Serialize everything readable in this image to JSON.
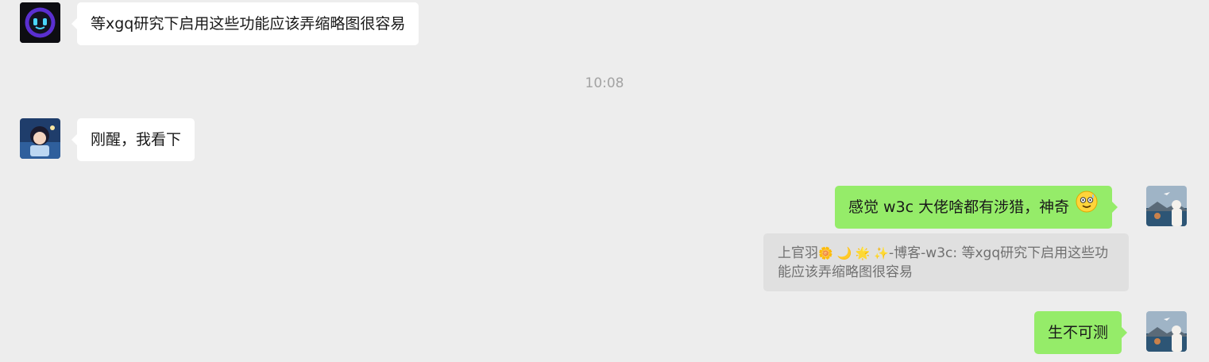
{
  "messages": [
    {
      "sender": "contact-bot",
      "text": "等xgq研究下启用这些功能应该弄缩略图很容易"
    },
    {
      "sender": "contact-girl",
      "text": "刚醒，我看下"
    },
    {
      "sender": "me",
      "text": "感觉 w3c 大佬啥都有涉猎，神奇"
    },
    {
      "sender": "me",
      "text": "生不可测"
    }
  ],
  "timestamp": "10:08",
  "quote": {
    "author": "上官羽",
    "author_emojis": "🌼 🌙 🌟 ✨",
    "text": "-博客-w3c: 等xgq研究下启用这些功能应该弄缩略图很容易"
  },
  "icons": {
    "bot_avatar": "robot-avatar-icon",
    "girl_avatar": "anime-girl-avatar-icon",
    "me_avatar": "seaside-photo-avatar-icon",
    "emoji": "grinning-sweat-face-icon"
  },
  "colors": {
    "background": "#ededed",
    "incoming_bubble": "#ffffff",
    "outgoing_bubble": "#95ec69",
    "quote_bg": "#e0e0e0",
    "timestamp": "#a3a3a3"
  }
}
